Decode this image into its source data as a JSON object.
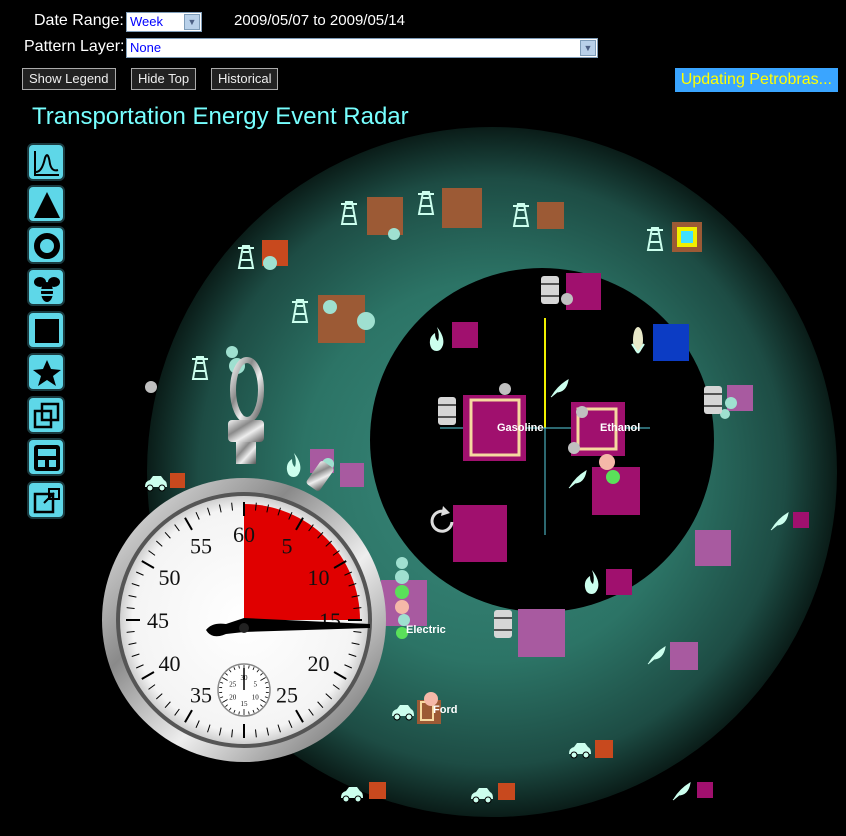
{
  "toolbar": {
    "date_range_label": "Date Range:",
    "date_range_value": "Week",
    "date_span": "2009/05/07 to 2009/05/14",
    "pattern_layer_label": "Pattern Layer:",
    "pattern_layer_value": "None",
    "buttons": [
      "Show Legend",
      "Hide Top",
      "Historical"
    ],
    "status": "Updating Petrobras..."
  },
  "title": "Transportation Energy Event Radar",
  "tools": [
    "chart-icon",
    "triangle-icon",
    "ring-icon",
    "bee-icon",
    "square-icon",
    "star-icon",
    "layers-icon",
    "layout-icon",
    "export-icon"
  ],
  "radar": {
    "labels": [
      "Gasoline",
      "Ethanol",
      "Electric",
      "Ford"
    ],
    "colors": {
      "outer_ring": "#2f7a6c",
      "magenta": "#a0106e",
      "brown": "#9c5a35",
      "orange_red": "#c8491e",
      "light_purple": "#a85aa0",
      "blue": "#0c3cc4",
      "axis_yellow": "#f0f000",
      "axis_cyan": "#58d0e0"
    }
  },
  "stopwatch": {
    "numbers": [
      "60",
      "5",
      "10",
      "15",
      "20",
      "25",
      "30",
      "35",
      "40",
      "45",
      "50",
      "55"
    ],
    "sub_numbers": [
      "30",
      "5",
      "10",
      "15",
      "20",
      "25"
    ],
    "elapsed_seconds": 15
  }
}
